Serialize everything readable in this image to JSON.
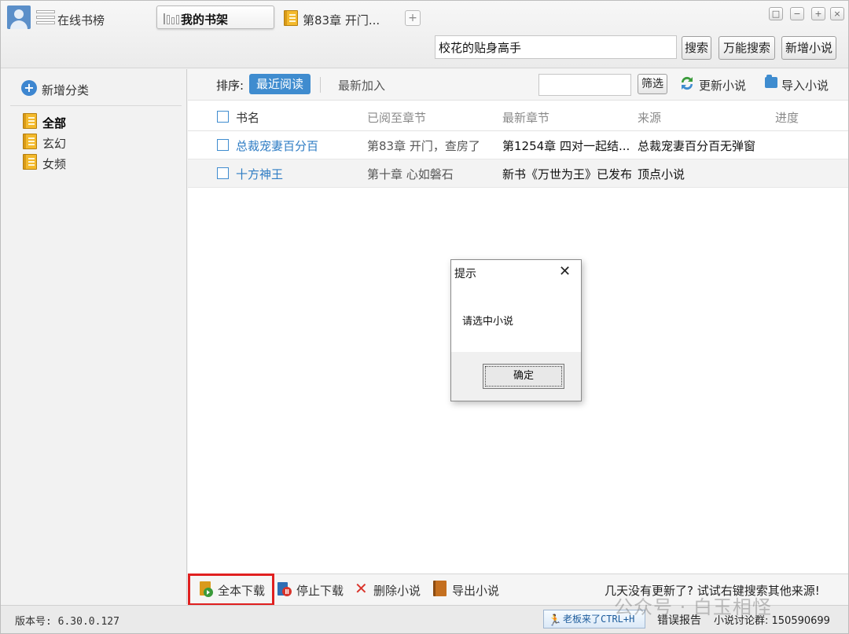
{
  "top": {
    "online_rank_label": "在线书榜",
    "my_shelf_label": "我的书架",
    "chapter_tab_label": "第83章  开门...",
    "add_tab_symbol": "+",
    "window_buttons": [
      "□",
      "−",
      "+",
      "×"
    ],
    "search_value": "校花的贴身高手",
    "search_btn": "搜索",
    "super_search_btn": "万能搜索",
    "add_novel_btn": "新增小说"
  },
  "sidebar": {
    "add_category": "新增分类",
    "categories": [
      {
        "label": "全部",
        "selected": true
      },
      {
        "label": "玄幻",
        "selected": false
      },
      {
        "label": "女频",
        "selected": false
      }
    ]
  },
  "toolbar": {
    "sort_label": "排序:",
    "sort_recent": "最近阅读",
    "sort_newest": "最新加入",
    "filter_placeholder": "",
    "filter_btn": "筛选",
    "update_btn": "更新小说",
    "import_btn": "导入小说"
  },
  "table": {
    "headers": [
      "书名",
      "已阅至章节",
      "最新章节",
      "来源",
      "进度"
    ],
    "rows": [
      {
        "name": "总裁宠妻百分百",
        "read_to": "第83章  开门，查房了",
        "latest": "第1254章  四对一起结...",
        "source": "总裁宠妻百分百无弹窗",
        "progress": ""
      },
      {
        "name": "十方神王",
        "read_to": "第十章 心如磐石",
        "latest": "新书《万世为王》已发布",
        "source": "顶点小说",
        "progress": ""
      }
    ]
  },
  "bottom": {
    "download_all": "全本下载",
    "stop_download": "停止下载",
    "delete_novel": "删除小说",
    "export_novel": "导出小说",
    "tip": "几天没有更新了? 试试右键搜索其他来源!"
  },
  "status": {
    "version": "版本号: 6.30.0.127",
    "boss_key": "老板来了CTRL+H",
    "error_report": "错误报告",
    "group": "小说讨论群: 150590699"
  },
  "watermark": "公众号 · 白玉相怪",
  "dialog": {
    "title": "提示",
    "close": "✕",
    "message": "请选中小说",
    "ok": "确定"
  },
  "colors": {
    "accent": "#3f8ccf",
    "highlight_border": "#e02020",
    "link": "#2e7cc4"
  }
}
